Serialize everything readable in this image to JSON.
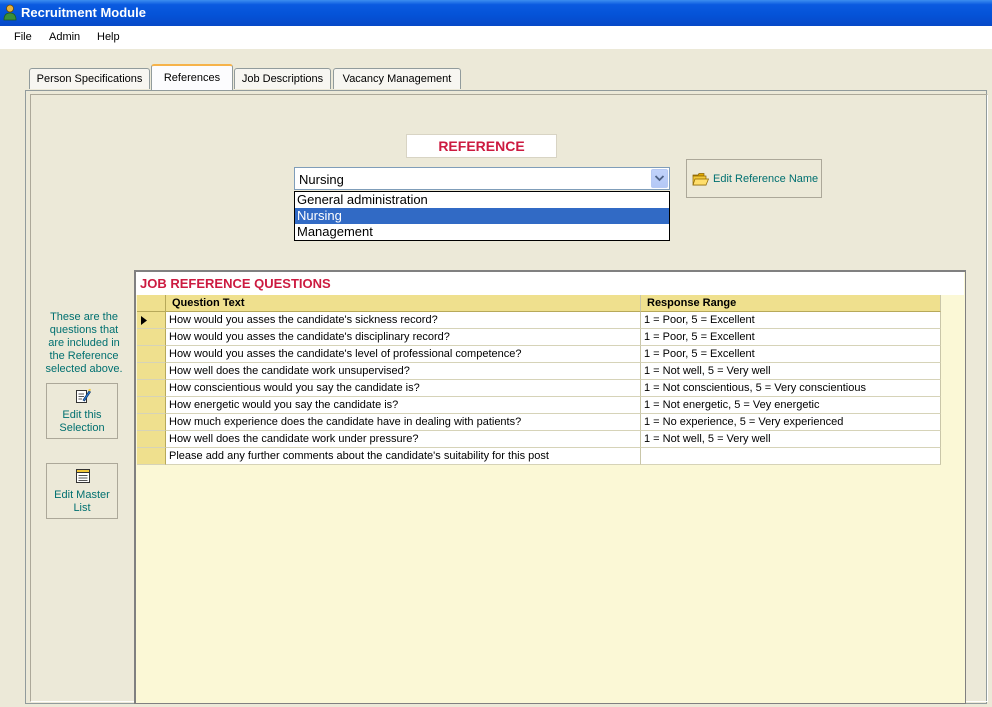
{
  "window": {
    "title": "Recruitment Module"
  },
  "menu": [
    {
      "label": "File"
    },
    {
      "label": "Admin"
    },
    {
      "label": "Help"
    }
  ],
  "tabs": [
    {
      "label": "Person Specifications",
      "active": false
    },
    {
      "label": "References",
      "active": true
    },
    {
      "label": "Job Descriptions",
      "active": false
    },
    {
      "label": "Vacancy Management",
      "active": false
    }
  ],
  "reference": {
    "heading": "REFERENCE",
    "selected": "Nursing",
    "options": [
      "General administration",
      "Nursing",
      "Management"
    ],
    "edit_button_label": "Edit Reference Name"
  },
  "sidebar": {
    "info_text": "These are the questions that are included in the Reference selected above.",
    "edit_selection_label": "Edit this Selection",
    "edit_master_label": "Edit Master List"
  },
  "grid": {
    "title": "JOB REFERENCE QUESTIONS",
    "columns": [
      "Question Text",
      "Response Range"
    ],
    "rows": [
      {
        "question": "How would you asses the candidate's sickness record?",
        "range": "1 = Poor, 5 = Excellent"
      },
      {
        "question": "How would you asses the candidate's disciplinary record?",
        "range": "1 = Poor, 5 = Excellent"
      },
      {
        "question": "How would you asses the candidate's level of professional competence?",
        "range": "1 = Poor, 5 = Excellent"
      },
      {
        "question": "How well does the candidate work unsupervised?",
        "range": "1 = Not well, 5 = Very well"
      },
      {
        "question": "How conscientious would you say the candidate is?",
        "range": "1 = Not conscientious, 5 = Very conscientious"
      },
      {
        "question": "How energetic would you say the candidate is?",
        "range": "1 = Not energetic, 5 = Vey energetic"
      },
      {
        "question": "How much experience does the candidate have in dealing with patients?",
        "range": "1 = No experience, 5 = Very experienced"
      },
      {
        "question": "How well does the candidate work under pressure?",
        "range": "1 = Not well, 5 = Very well"
      },
      {
        "question": "Please add any further comments about the candidate's suitability for this post",
        "range": ""
      }
    ]
  },
  "colors": {
    "accent_red": "#cc1a40",
    "teal_text": "#007070",
    "grid_header": "#efe08e",
    "grid_background": "#fbf8d6",
    "selection_blue": "#316ac5",
    "titlebar_blue": "#0553d8"
  },
  "icons": {
    "app": "person-icon",
    "edit_reference": "folder-icon",
    "edit_selection": "edit-document-icon",
    "edit_master": "list-document-icon",
    "combo": "chevron-down-icon",
    "current_row": "row-pointer-icon"
  }
}
